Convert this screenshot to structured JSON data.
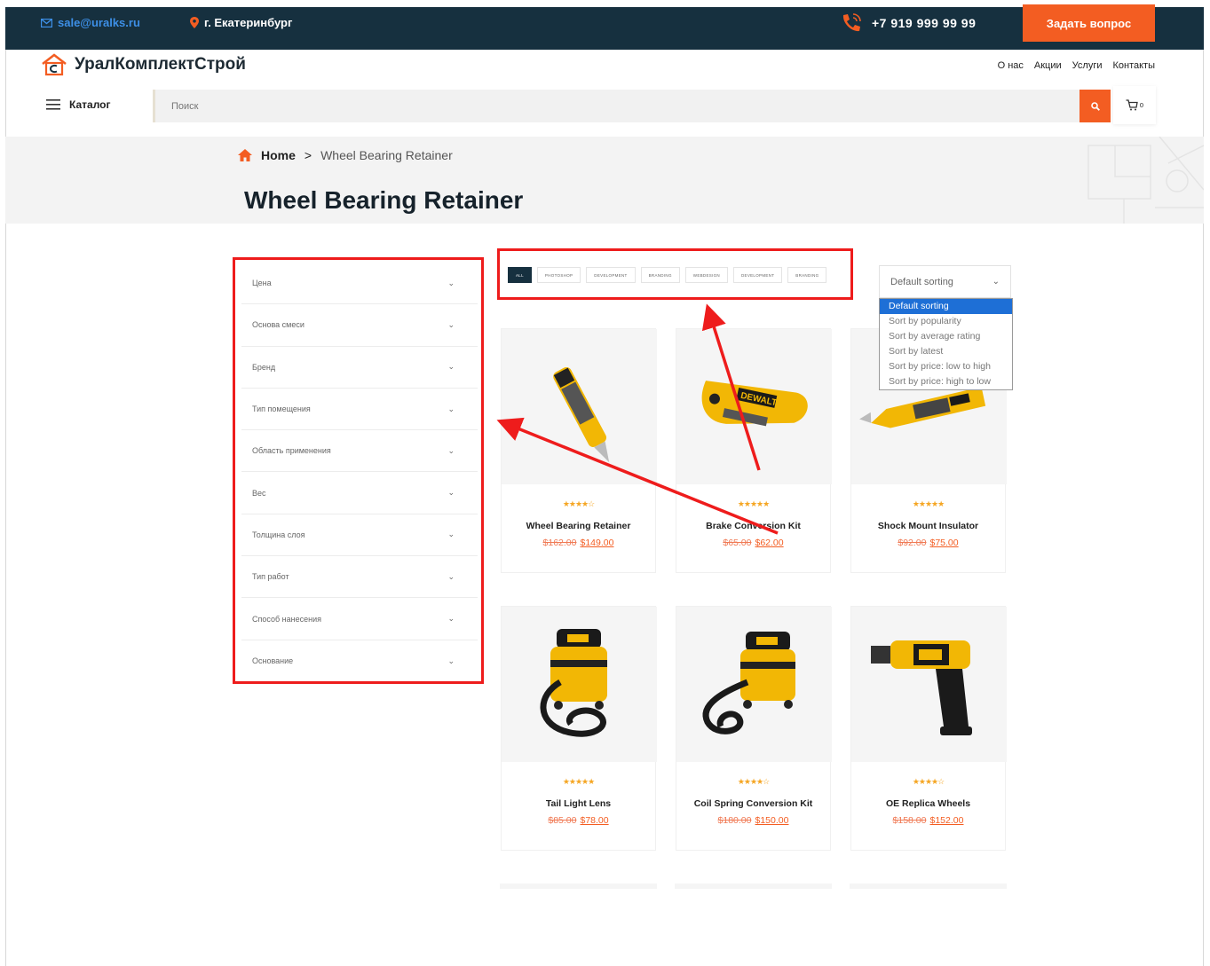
{
  "topbar": {
    "email": "sale@uralks.ru",
    "city": "г. Екатеринбург",
    "phone": "+7 919 999 99 99",
    "ask_button": "Задать вопрос"
  },
  "header": {
    "logo_text": "УралКомплектСтрой",
    "menu": [
      "О нас",
      "Акции",
      "Услуги",
      "Контакты"
    ],
    "catalog_label": "Каталог",
    "search_placeholder": "Поиск",
    "cart_count": "0"
  },
  "breadcrumb": {
    "home": "Home",
    "separator": ">",
    "current": "Wheel Bearing Retainer"
  },
  "page_title": "Wheel Bearing Retainer",
  "filters": [
    "Цена",
    "Основа смеси",
    "Бренд",
    "Тип помещения",
    "Область применения",
    "Вес",
    "Толщина слоя",
    "Тип работ",
    "Способ нанесения",
    "Основание"
  ],
  "tabs": [
    "ALL",
    "PHOTOSHOP",
    "DEVELOPMENT",
    "BRANDING",
    "WEBDESIGN",
    "DEVELOPMENT",
    "BRANDING"
  ],
  "sorting": {
    "selected": "Default sorting",
    "options": [
      "Default sorting",
      "Sort by popularity",
      "Sort by average rating",
      "Sort by latest",
      "Sort by price: low to high",
      "Sort by price: high to low"
    ]
  },
  "products": [
    {
      "name": "Wheel Bearing Retainer",
      "old_price": "$162.00",
      "price": "$149.00",
      "rating": 4
    },
    {
      "name": "Brake Conversion Kit",
      "old_price": "$65.00",
      "price": "$62.00",
      "rating": 5
    },
    {
      "name": "Shock Mount Insulator",
      "old_price": "$92.00",
      "price": "$75.00",
      "rating": 5
    },
    {
      "name": "Tail Light Lens",
      "old_price": "$85.00",
      "price": "$78.00",
      "rating": 5
    },
    {
      "name": "Coil Spring Conversion Kit",
      "old_price": "$180.00",
      "price": "$150.00",
      "rating": 4
    },
    {
      "name": "OE Replica Wheels",
      "old_price": "$158.00",
      "price": "$152.00",
      "rating": 4
    }
  ],
  "colors": {
    "topbar_bg": "#16303f",
    "accent": "#f35d22",
    "email_link": "#3d8fe6",
    "star": "#f5a623",
    "annotation": "#ee1c1c"
  }
}
